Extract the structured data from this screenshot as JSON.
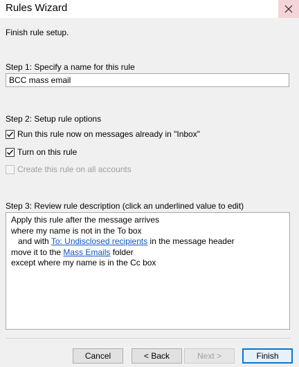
{
  "window": {
    "title": "Rules Wizard"
  },
  "header": {
    "text": "Finish rule setup."
  },
  "step1": {
    "label": "Step 1: Specify a name for this rule",
    "name_value": "BCC mass email"
  },
  "step2": {
    "label": "Step 2: Setup rule options",
    "options": [
      {
        "label": "Run this rule now on messages already in \"Inbox\"",
        "checked": true,
        "enabled": true
      },
      {
        "label": "Turn on this rule",
        "checked": true,
        "enabled": true
      },
      {
        "label": "Create this rule on all accounts",
        "checked": false,
        "enabled": false
      }
    ]
  },
  "step3": {
    "label": "Step 3: Review rule description (click an underlined value to edit)",
    "line1": "Apply this rule after the message arrives",
    "line2": "where my name is not in the To box",
    "line3_prefix": "and with ",
    "line3_link": "To: Undisclosed recipients",
    "line3_suffix": " in the message header",
    "line4_prefix": "move it to the ",
    "line4_link": "Mass Emails",
    "line4_suffix": " folder",
    "line5": "except where my name is in the Cc box"
  },
  "buttons": {
    "cancel": "Cancel",
    "back": "< Back",
    "next": "Next >",
    "finish": "Finish"
  },
  "icons": {
    "close": "close-icon",
    "check": "checkmark-icon"
  },
  "colors": {
    "link": "#1155bb",
    "close_bg": "#f4d4d8",
    "primary_border": "#0078d7"
  }
}
